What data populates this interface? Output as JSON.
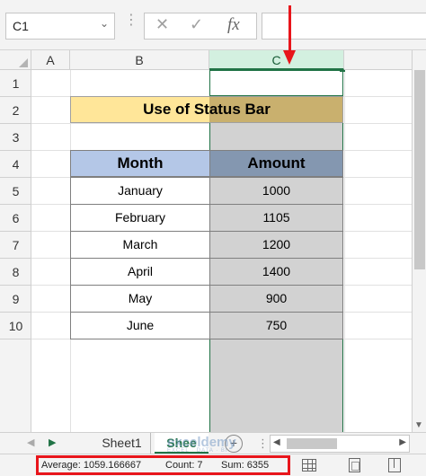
{
  "formula_bar": {
    "name_box": "C1",
    "cancel_icon": "✕",
    "enter_icon": "✓",
    "fx_label": "fx",
    "formula_value": ""
  },
  "columns": [
    "A",
    "B",
    "C"
  ],
  "selected_column": "C",
  "rows": [
    "1",
    "2",
    "3",
    "4",
    "5",
    "6",
    "7",
    "8",
    "9",
    "10"
  ],
  "sheet": {
    "title": "Use of Status Bar",
    "header_month": "Month",
    "header_amount": "Amount",
    "data": [
      {
        "month": "January",
        "amount": "1000"
      },
      {
        "month": "February",
        "amount": "1105"
      },
      {
        "month": "March",
        "amount": "1200"
      },
      {
        "month": "April",
        "amount": "1400"
      },
      {
        "month": "May",
        "amount": "900"
      },
      {
        "month": "June",
        "amount": "750"
      }
    ]
  },
  "tabs": {
    "sheet1": "Sheet1",
    "sheet2": "Shee",
    "add_label": "+"
  },
  "watermark": {
    "name": "exceldemy",
    "tagline": "EXCEL · DATA · BI"
  },
  "status": {
    "average_label": "Average:",
    "average_value": "1059.166667",
    "count_label": "Count:",
    "count_value": "7",
    "sum_label": "Sum:",
    "sum_value": "6355"
  },
  "colors": {
    "accent_green": "#217346",
    "highlight_red": "#e8151b",
    "title_fill": "#ffe699",
    "header_month_fill": "#b4c7e7",
    "header_amount_fill": "#8497b0"
  }
}
